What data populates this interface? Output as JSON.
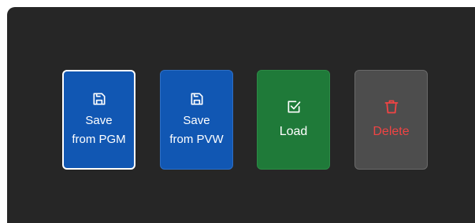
{
  "buttons": {
    "save_pgm": {
      "line1": "Save",
      "line2": "from PGM",
      "icon": "floppy-disk-icon"
    },
    "save_pvw": {
      "line1": "Save",
      "line2": "from PVW",
      "icon": "floppy-disk-icon"
    },
    "load": {
      "label": "Load",
      "icon": "checkbox-icon"
    },
    "delete": {
      "label": "Delete",
      "icon": "trash-icon"
    }
  },
  "colors": {
    "panel_bg": "#262626",
    "save_bg": "#1157b3",
    "load_bg": "#1f7a39",
    "delete_bg": "#4d4d4d",
    "delete_text": "#ef4444",
    "selected_border": "#ffffff"
  }
}
